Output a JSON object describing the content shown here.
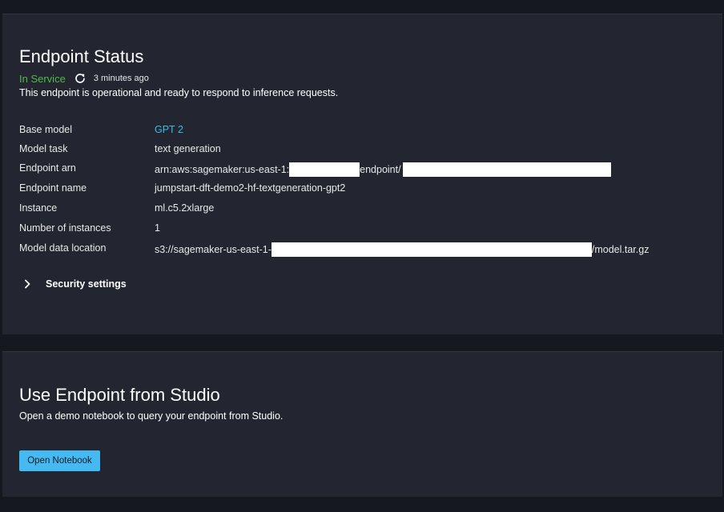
{
  "status_panel": {
    "title": "Endpoint Status",
    "status": "In Service",
    "status_color": "#4fb84a",
    "refresh_icon": "refresh-icon",
    "updated": "3 minutes ago",
    "description": "This endpoint is operational and ready to respond to inference requests.",
    "details": [
      {
        "label": "Base model",
        "value": "GPT 2"
      },
      {
        "label": "Model task",
        "value": "text generation"
      },
      {
        "label": "Endpoint arn",
        "value_prefix": "arn:aws:sagemaker:us-east-1:",
        "value_mid": "endpoint/"
      },
      {
        "label": "Endpoint name",
        "value": "jumpstart-dft-demo2-hf-textgeneration-gpt2"
      },
      {
        "label": "Instance",
        "value": "ml.c5.2xlarge"
      },
      {
        "label": "Number of instances",
        "value": "1"
      },
      {
        "label": "Model data location",
        "value_prefix": "s3://sagemaker-us-east-1-",
        "value_suffix": "/model.tar.gz"
      }
    ],
    "security_settings_label": "Security settings",
    "link_color": "#3fb9e6"
  },
  "studio_panel": {
    "title": "Use Endpoint from Studio",
    "description": "Open a demo notebook to query your endpoint from Studio.",
    "open_notebook_label": "Open Notebook",
    "button_color": "#44b9f2"
  }
}
